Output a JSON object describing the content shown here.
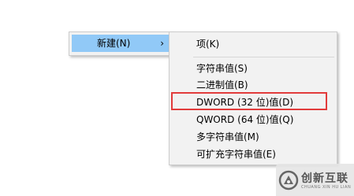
{
  "context_menu": {
    "items": [
      {
        "label": "新建(N)",
        "submenu_arrow": "›"
      }
    ]
  },
  "submenu": {
    "items": [
      {
        "label": "项(K)"
      },
      {
        "label": "字符串值(S)"
      },
      {
        "label": "二进制值(B)"
      },
      {
        "label": "DWORD (32 位)值(D)"
      },
      {
        "label": "QWORD (64 位)值(Q)"
      },
      {
        "label": "多字符串值(M)"
      },
      {
        "label": "可扩充字符串值(E)"
      }
    ]
  },
  "highlight": {
    "color": "#e23b3b",
    "target": "DWORD (32 位)值(D)"
  },
  "watermark": {
    "text": "创新互联",
    "subtext": "CHUANG XIN HU LIAN",
    "icon": "logo-icon"
  }
}
